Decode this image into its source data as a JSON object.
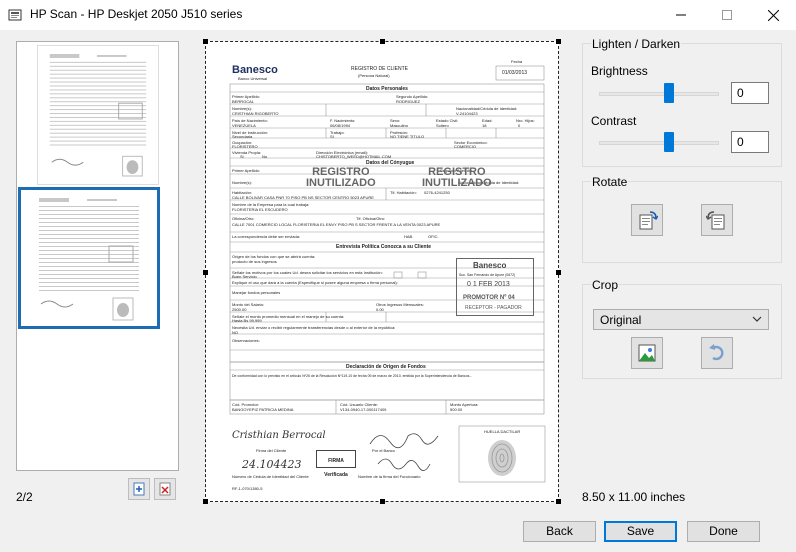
{
  "window": {
    "title": "HP Scan - HP Deskjet 2050 J510 series",
    "minimize_glyph": "—",
    "maximize_glyph": "☐",
    "close_glyph": "✕"
  },
  "thumbnails": {
    "page_counter": "2/2",
    "count": 2,
    "selected_index": 2
  },
  "document": {
    "bank_name": "Banesco",
    "bank_subtitle": "Banco Universal",
    "form_title": "REGISTRO DE CLIENTE",
    "form_subtitle": "(Persona Natural)",
    "date_label": "Fecha",
    "date_value": "01/03/2013",
    "section_personal": "Datos Personales",
    "first_name_label": "Primer Apellido:",
    "first_name_value": "BERROCAL",
    "second_name_label": "Segundo Apellido:",
    "second_name_value": "RODRIGUEZ",
    "names_label": "Nombre(s):",
    "names_value": "CRISTHIAN RIGOBERTO",
    "nationality_label": "Nacionalidad/Cédula de Identidad:",
    "nationality_value": "V-24104423",
    "country_label": "País de Nacimiento:",
    "country_value": "VENEZUELA",
    "birth_label": "F. Nacimiento:",
    "birth_value": "06/08/1994",
    "sex_label": "Sexo:",
    "sex_value": "Masculino",
    "civil_label": "Estado Civil:",
    "civil_value": "Soltero",
    "age_label": "Edad:",
    "age_value": "18",
    "children_label": "Nro. Hijos:",
    "children_value": "0",
    "education_label": "Nivel de Instrucción:",
    "education_value": "Secundaria",
    "job_label": "Trabajo:",
    "job_value": "SI",
    "profession_label": "Profesión:",
    "profession_value": "NO TIENE TITULO",
    "occupation_label": "Ocupación:",
    "occupation_value": "FLORISTERO",
    "sector_label": "Sector Económico:",
    "sector_value": "COMERCIO",
    "housing_label": "Vivienda Propia:",
    "housing_si": "Si",
    "housing_no": "No",
    "email_label": "Dirección Electrónica (email):",
    "email_value": "CHISTOBERTO_WEED@HOTMAIL.COM",
    "section_spouse": "Datos del Cónyugue",
    "spouse_first": "Primer Apellido:",
    "spouse_second": "Segundo Apellido:",
    "spouse_names": "Nombre(s):",
    "spouse_id": "Nacionalidad/Cédula de Identidad:",
    "stamp_void": "REGISTRO",
    "stamp_void2": "INUTILIZADO",
    "home_label": "Habitación:",
    "phone_label": "Tlf. Habitación:",
    "phone_value": "0276-4241250",
    "address_value": "CALLE BOLIVAR CASA PNR 70 PISO PB NS SECTOR CENTRO 5023 APURE",
    "company_label": "Nombre de la Empresa para la cual trabaja:",
    "company_value": "FLORISTERIA EL ESCUDERO",
    "office_label": "Oficina/Otro:",
    "office_phone_label": "Tlf. Oficina/Otro:",
    "office_address": "CALLE 7001 COMERCIO LOCAL FLORISTERIA EL ENVY PISO PB S SECTOR FRENTE A LA VENTA 0023 APURE",
    "mail_label": "La correspondencia debe ser enviada:",
    "mail_hab": "HAB.",
    "mail_ofic": "OFIC.",
    "section_interview": "Entrevista Política Conozca a su Cliente",
    "origin_label": "Origen de los fondos con que se abrirá cuenta:",
    "origin_value": "producto de sus ingresos",
    "reasons_label": "Señale los motivos por los cuales Ud. desea solicitar los servicios en esta Institución:",
    "reasons_value": "Buen Servicio",
    "explain_label": "Explique el uso que dará a la cuenta (Especifique si posee alguna empresa o firma personal):",
    "explain_value": "Manejar fondos personales",
    "salary_label": "Monto del Salario:",
    "salary_value": "2500.00",
    "other_income_label": "Otros Ingresos Mensuales:",
    "other_income_value": "0.00",
    "monthly_label": "Señale el monto promedio mensual en el manejo de su cuenta:",
    "monthly_value": "Hasta Bs 99.999",
    "receive_label": "Necesita Ud. enviar o recibir regularmente transferencias desde o al exterior de la república:",
    "receive_value": "NO",
    "obs_label": "Observaciones:",
    "section_declaration": "Declaración de Origen de Fondos",
    "declaration_text": "De conformidad con lo previsto en el artículo Nº26 de la Resolución Nº119-10 de fecha 09 de marzo de 2010, emitida por la Superintendencia de Bancos...",
    "promoter_label": "Cód. Promotor:",
    "promoter_value": "BANGOYEPIZ PATRICIA MEDINA",
    "client_id_label": "Cód. Usuario Cliente:",
    "client_id_value": "V134-0940-17-000117409",
    "amount_label": "Monto Apertura:",
    "amount_value": "500.00",
    "bank_stamp_title": "Banesco",
    "bank_stamp_line": "Suc. San Fernando de Apure (0672)",
    "bank_stamp_date": "0 1  FEB  2013",
    "bank_stamp_promoter": "PROMOTOR Nº 04",
    "bank_stamp_role": "RECEPTOR - PAGADOR",
    "client_signature": "Cristhian Berrocal",
    "client_signature_label": "Firma del Cliente",
    "verified_stamp": "FIRMA",
    "verified_stamp2": "Verificada",
    "bank_signature_label": "Por el Banco",
    "id_number_handwritten": "24.104423",
    "id_number_label": "Número de Cédula de Identidad del Cliente",
    "officer_label": "Nombre de la firma del Funcionario",
    "fingerprint_label": "HUELLA DACTILAR",
    "form_code": "RF-1-070/1380-5"
  },
  "adjust": {
    "group_title": "Lighten / Darken",
    "brightness_label": "Brightness",
    "brightness_value": "0",
    "brightness_level": 0.5,
    "contrast_label": "Contrast",
    "contrast_value": "0",
    "contrast_level": 0.5
  },
  "rotate": {
    "group_title": "Rotate"
  },
  "crop": {
    "group_title": "Crop",
    "selected_option": "Original"
  },
  "page_size": "8.50 x 11.00 inches",
  "buttons": {
    "back": "Back",
    "save": "Save",
    "done": "Done"
  },
  "colors": {
    "accent": "#0078d7",
    "thumb_selected": "#1e6cb4",
    "panel_bg": "#f0f0f0"
  }
}
